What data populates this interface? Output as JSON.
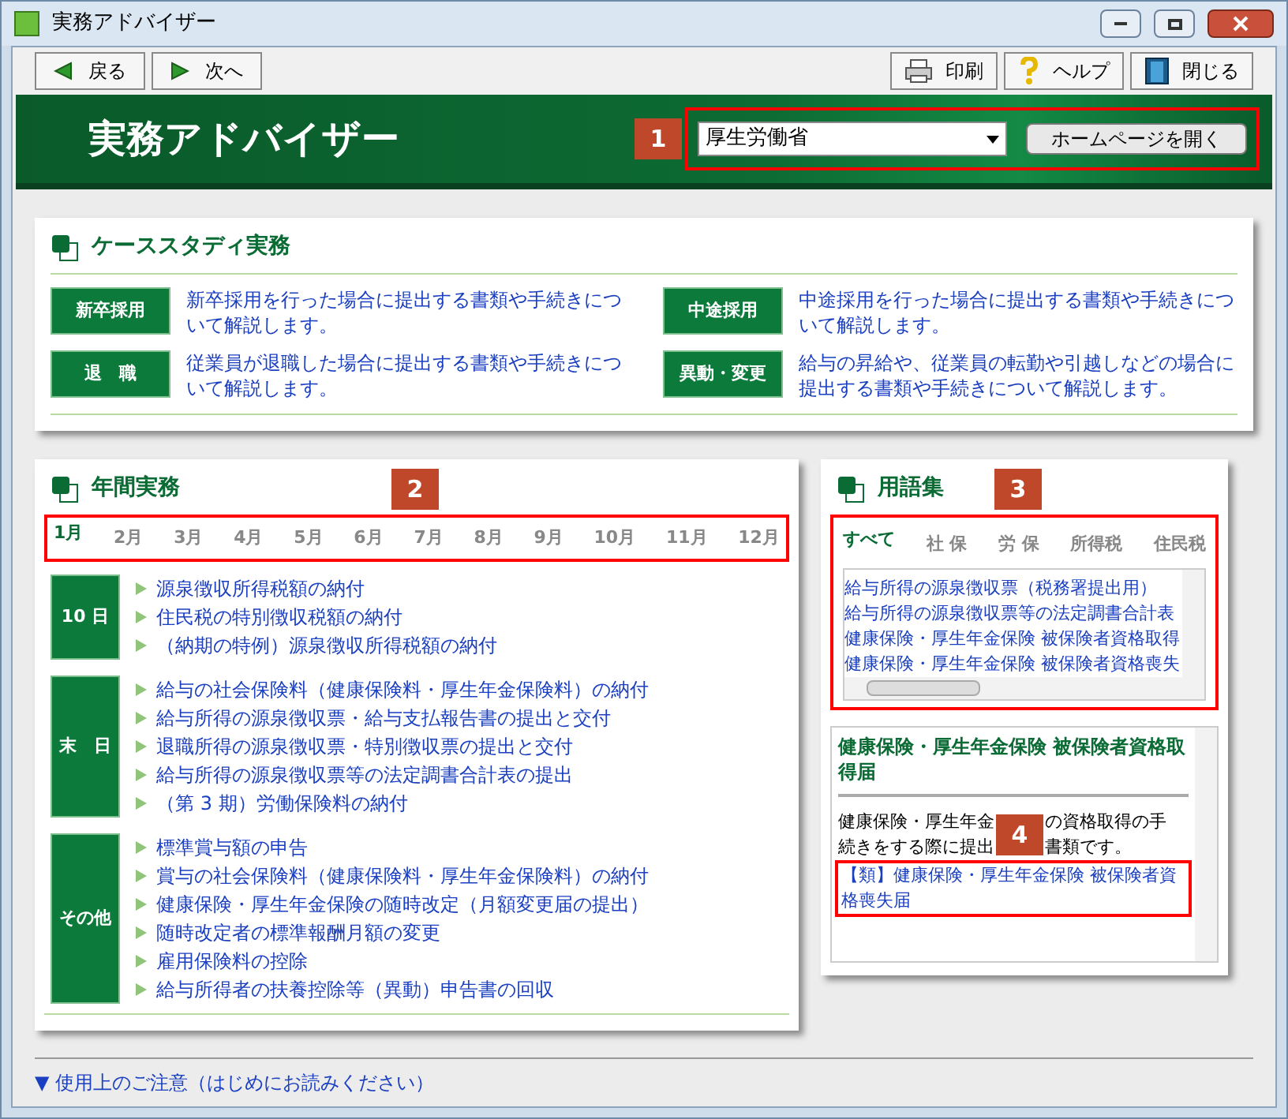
{
  "window": {
    "title": "実務アドバイザー"
  },
  "toolbar": {
    "left": [
      {
        "label": "戻る",
        "kind": "back"
      },
      {
        "label": "次へ",
        "kind": "forward"
      }
    ],
    "right": [
      {
        "label": "印刷",
        "kind": "print"
      },
      {
        "label": "ヘルプ",
        "kind": "help"
      },
      {
        "label": "閉じる",
        "kind": "close"
      }
    ]
  },
  "header": {
    "title": "実務アドバイザー",
    "marker": "1",
    "dropdown": {
      "value": "厚生労働省"
    },
    "button": "ホームページを開く"
  },
  "case_study": {
    "title": "ケーススタディ実務",
    "items": [
      {
        "label": "新卒採用",
        "text": "新卒採用を行った場合に提出する書類や手続きについて解説します。"
      },
      {
        "label": "中途採用",
        "text": "中途採用を行った場合に提出する書類や手続きについて解説します。"
      },
      {
        "label": "退　職",
        "text": "従業員が退職した場合に提出する書類や手続きについて解説します。"
      },
      {
        "label": "異動・変更",
        "text": "給与の昇給や、従業員の転勤や引越しなどの場合に提出する書類や手続きについて解説します。"
      }
    ]
  },
  "annual": {
    "title": "年間実務",
    "marker": "2",
    "months": [
      {
        "label": "1月",
        "selected": true
      },
      {
        "label": "2月",
        "selected": false
      },
      {
        "label": "3月",
        "selected": false
      },
      {
        "label": "4月",
        "selected": false
      },
      {
        "label": "5月",
        "selected": false
      },
      {
        "label": "6月",
        "selected": false
      },
      {
        "label": "7月",
        "selected": false
      },
      {
        "label": "8月",
        "selected": false
      },
      {
        "label": "9月",
        "selected": false
      },
      {
        "label": "10月",
        "selected": false
      },
      {
        "label": "11月",
        "selected": false
      },
      {
        "label": "12月",
        "selected": false
      }
    ],
    "groups": [
      {
        "label": "10 日",
        "items": [
          "源泉徴収所得税額の納付",
          "住民税の特別徴収税額の納付",
          "（納期の特例）源泉徴収所得税額の納付"
        ]
      },
      {
        "label": "末　日",
        "items": [
          "給与の社会保険料（健康保険料・厚生年金保険料）の納付",
          "給与所得の源泉徴収票・給与支払報告書の提出と交付",
          "退職所得の源泉徴収票・特別徴収票の提出と交付",
          "給与所得の源泉徴収票等の法定調書合計表の提出",
          "（第 3 期）労働保険料の納付"
        ]
      },
      {
        "label": "その他",
        "items": [
          "標準賞与額の申告",
          "賞与の社会保険料（健康保険料・厚生年金保険料）の納付",
          "健康保険・厚生年金保険の随時改定（月額変更届の提出）",
          "随時改定者の標準報酬月額の変更",
          "雇用保険料の控除",
          "給与所得者の扶養控除等（異動）申告書の回収"
        ]
      }
    ]
  },
  "glossary": {
    "title": "用語集",
    "marker": "3",
    "tabs": [
      {
        "label": "すべて",
        "selected": true
      },
      {
        "label": "社 保",
        "selected": false
      },
      {
        "label": "労 保",
        "selected": false
      },
      {
        "label": "所得税",
        "selected": false
      },
      {
        "label": "住民税",
        "selected": false
      }
    ],
    "terms": [
      "給与所得の源泉徴収票（税務署提出用）",
      "給与所得の源泉徴収票等の法定調書合計表",
      "健康保険・厚生年金保険 被保険者資格取得",
      "健康保険・厚生年金保険 被保険者資格喪失"
    ],
    "detail": {
      "title": "健康保険・厚生年金保険 被保険者資格取得届",
      "description_lines": [
        [
          "健康保険・厚生年金",
          "の資格取得の手"
        ],
        [
          "続きをする際に提出",
          "書類です。"
        ]
      ],
      "marker": "4",
      "link": "【類】健康保険・厚生年金保険 被保険者資格喪失届"
    }
  },
  "footer": {
    "link": "▼ 使用上のご注意（はじめにお読みください）"
  }
}
